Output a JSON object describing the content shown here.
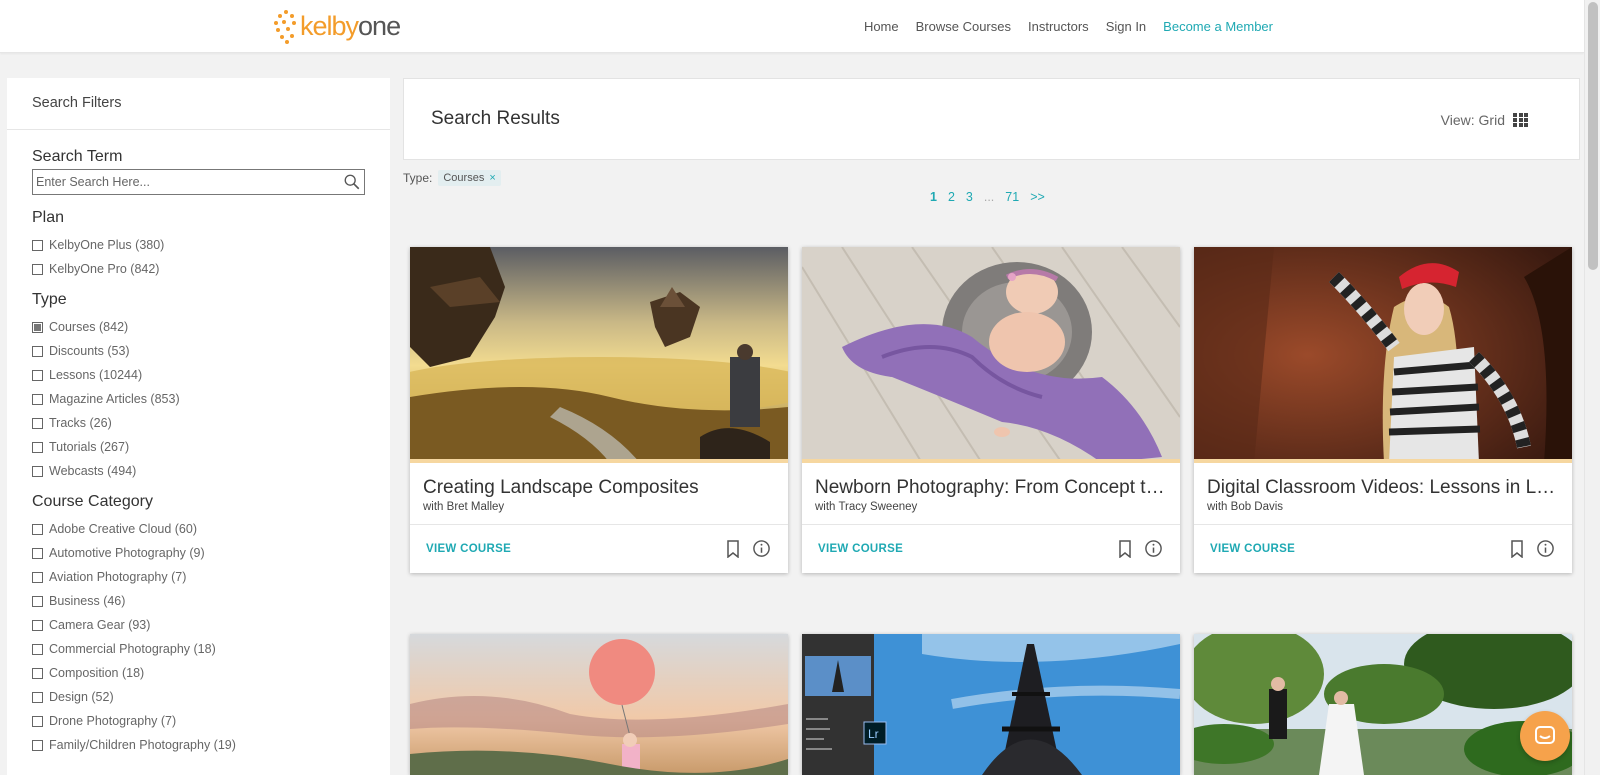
{
  "header": {
    "logo_kelby": "kelby",
    "logo_one": "one",
    "nav": [
      "Home",
      "Browse Courses",
      "Instructors",
      "Sign In",
      "Become a Member"
    ]
  },
  "sidebar": {
    "title": "Search Filters",
    "search_term_label": "Search Term",
    "search_placeholder": "Enter Search Here...",
    "groups": [
      {
        "title": "Plan",
        "items": [
          {
            "label": "KelbyOne Plus (380)",
            "checked": false
          },
          {
            "label": "KelbyOne Pro (842)",
            "checked": false
          }
        ]
      },
      {
        "title": "Type",
        "items": [
          {
            "label": "Courses (842)",
            "checked": true
          },
          {
            "label": "Discounts (53)",
            "checked": false
          },
          {
            "label": "Lessons (10244)",
            "checked": false
          },
          {
            "label": "Magazine Articles (853)",
            "checked": false
          },
          {
            "label": "Tracks (26)",
            "checked": false
          },
          {
            "label": "Tutorials (267)",
            "checked": false
          },
          {
            "label": "Webcasts (494)",
            "checked": false
          }
        ]
      },
      {
        "title": "Course Category",
        "items": [
          {
            "label": "Adobe Creative Cloud (60)",
            "checked": false
          },
          {
            "label": "Automotive Photography (9)",
            "checked": false
          },
          {
            "label": "Aviation Photography (7)",
            "checked": false
          },
          {
            "label": "Business (46)",
            "checked": false
          },
          {
            "label": "Camera Gear (93)",
            "checked": false
          },
          {
            "label": "Commercial Photography (18)",
            "checked": false
          },
          {
            "label": "Composition (18)",
            "checked": false
          },
          {
            "label": "Design (52)",
            "checked": false
          },
          {
            "label": "Drone Photography (7)",
            "checked": false
          },
          {
            "label": "Family/Children Photography (19)",
            "checked": false
          }
        ]
      }
    ]
  },
  "results": {
    "title": "Search Results",
    "view_label": "View: Grid",
    "type_label": "Type:",
    "type_chip": "Courses",
    "chip_close": "×",
    "pagination": [
      "1",
      "2",
      "3",
      "...",
      "71",
      ">>"
    ],
    "view_course_label": "VIEW COURSE",
    "cards": [
      {
        "title": "Creating Landscape Composites",
        "instructor": "with Bret Malley"
      },
      {
        "title": "Newborn Photography: From Concept to Creation",
        "instructor": "with Tracy Sweeney"
      },
      {
        "title": "Digital Classroom Videos: Lessons in Lightroom",
        "instructor": "with Bob Davis"
      }
    ],
    "lr_badge": "Lr"
  },
  "colors": {
    "accent": "#1fa9b3",
    "brand": "#f39c2a",
    "chat": "#f6a24b"
  }
}
